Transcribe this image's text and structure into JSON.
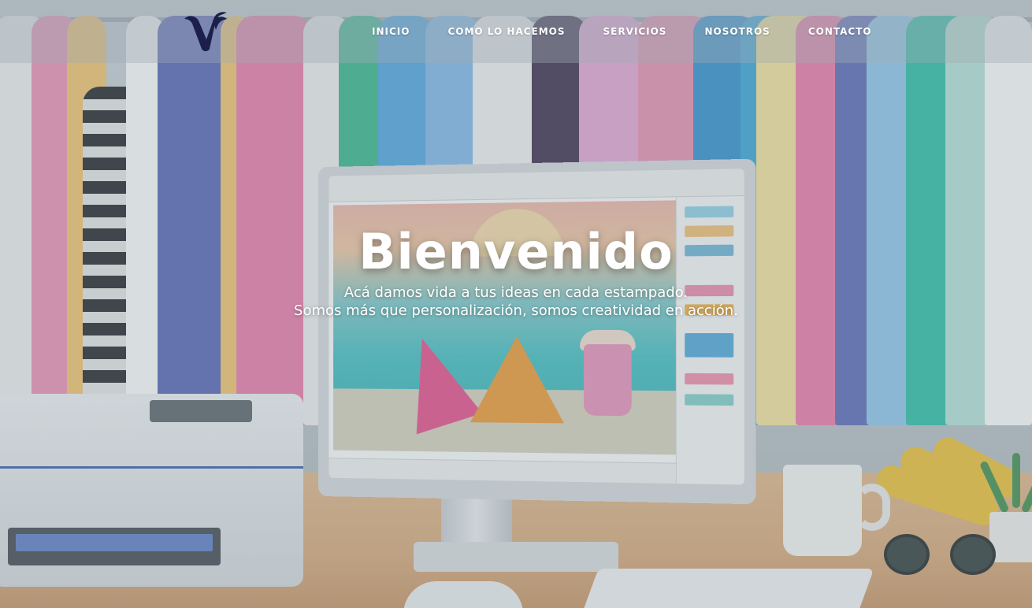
{
  "nav": {
    "items": [
      {
        "label": "INICIO"
      },
      {
        "label": "COMO LO HACEMOS"
      },
      {
        "label": "SERVICIOS"
      },
      {
        "label": "NOSOTROS"
      },
      {
        "label": "CONTACTO"
      }
    ]
  },
  "hero": {
    "title": "Bienvenido",
    "line1": "Acá damos vida a tus ideas en cada estampado.",
    "line2": "Somos más que personalización, somos creatividad en acción."
  },
  "colors": {
    "logo": "#1c1f4a",
    "nav_text": "#ffffff",
    "hero_text": "#ffffff"
  },
  "icons": {
    "logo": "v-logo-icon"
  }
}
